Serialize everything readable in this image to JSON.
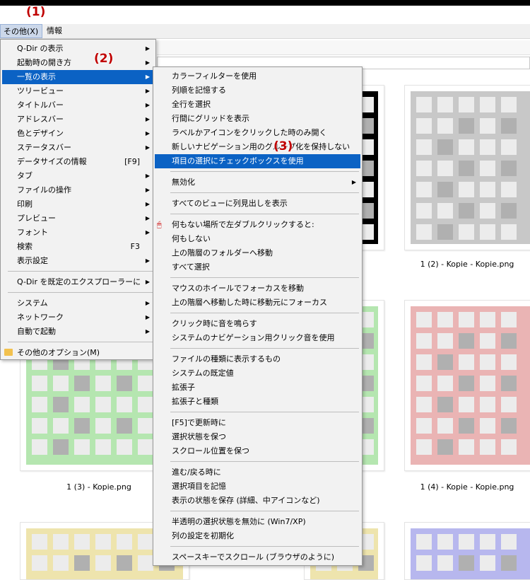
{
  "annotations": {
    "a1": "(1)",
    "a2": "(2)",
    "a3": "(3)"
  },
  "menubar": {
    "items": [
      "その他(X)",
      "情報"
    ]
  },
  "main_menu": {
    "items": [
      {
        "label": "Q-Dir の表示",
        "submenu": true
      },
      {
        "label": "起動時の開き方",
        "submenu": true
      },
      {
        "label": "一覧の表示",
        "submenu": true,
        "highlighted": true
      },
      {
        "label": "ツリービュー",
        "submenu": true
      },
      {
        "label": "タイトルバー",
        "submenu": true
      },
      {
        "label": "アドレスバー",
        "submenu": true
      },
      {
        "label": "色とデザイン",
        "submenu": true
      },
      {
        "label": "ステータスバー",
        "submenu": true
      },
      {
        "label": "データサイズの情報",
        "shortcut": "[F9]"
      },
      {
        "label": "タブ",
        "submenu": true
      },
      {
        "label": "ファイルの操作",
        "submenu": true
      },
      {
        "label": "印刷",
        "submenu": true
      },
      {
        "label": "プレビュー",
        "submenu": true
      },
      {
        "label": "フォント",
        "submenu": true
      },
      {
        "label": "検索",
        "shortcut": "F3"
      },
      {
        "label": "表示設定",
        "submenu": true
      },
      {
        "separator": true
      },
      {
        "label": "Q-Dir を既定のエクスプローラーに",
        "submenu": true
      },
      {
        "separator": true
      },
      {
        "label": "システム",
        "submenu": true
      },
      {
        "label": "ネットワーク",
        "submenu": true
      },
      {
        "label": "自動で起動",
        "submenu": true
      },
      {
        "separator": true
      },
      {
        "label": "その他のオプション(M)",
        "icon": "folder-icon"
      }
    ]
  },
  "sub_menu": {
    "items": [
      {
        "label": "カラーフィルターを使用"
      },
      {
        "label": "列順を記憶する"
      },
      {
        "label": "全行を選択"
      },
      {
        "label": "行間にグリッドを表示"
      },
      {
        "label": "ラベルかアイコンをクリックした時のみ開く"
      },
      {
        "label": "新しいナビゲーション用のグループ化を保持しない"
      },
      {
        "label": "項目の選択にチェックボックスを使用",
        "highlighted": true
      },
      {
        "separator": true
      },
      {
        "label": "無効化",
        "submenu": true
      },
      {
        "separator": true
      },
      {
        "label": "すべてのビューに列見出しを表示"
      },
      {
        "separator": true
      },
      {
        "label": "何もない場所で左ダブルクリックすると:",
        "icon": "mouse-icon"
      },
      {
        "label": "何もしない"
      },
      {
        "label": "上の階層のフォルダーへ移動"
      },
      {
        "label": "すべて選択"
      },
      {
        "separator": true
      },
      {
        "label": "マウスのホイールでフォーカスを移動"
      },
      {
        "label": "上の階層へ移動した時に移動元にフォーカス"
      },
      {
        "separator": true
      },
      {
        "label": "クリック時に音を鳴らす"
      },
      {
        "label": "システムのナビゲーション用クリック音を使用"
      },
      {
        "separator": true
      },
      {
        "label": "ファイルの種類に表示するもの"
      },
      {
        "label": "システムの既定値"
      },
      {
        "label": "拡張子"
      },
      {
        "label": "拡張子と種類"
      },
      {
        "separator": true
      },
      {
        "label": "[F5]で更新時に"
      },
      {
        "label": "選択状態を保つ"
      },
      {
        "label": "スクロール位置を保つ"
      },
      {
        "separator": true
      },
      {
        "label": "進む/戻る時に"
      },
      {
        "label": "選択項目を記憶"
      },
      {
        "label": "表示の状態を保存 (詳細、中アイコンなど)"
      },
      {
        "separator": true
      },
      {
        "label": "半透明の選択状態を無効に (Win7/XP)"
      },
      {
        "label": "列の設定を初期化"
      },
      {
        "separator": true
      },
      {
        "label": "スペースキーでスクロール (ブラウザのように)"
      }
    ]
  },
  "files": [
    {
      "name": "1 (2) - Kopie - Kopie.png",
      "color": "#c8c8c8"
    },
    {
      "name": "1 (3) - Kopie.png",
      "color": "#b5e6b0"
    },
    {
      "name": "1 (4) - Kopie - Kopie.png",
      "color": "#eab4b4"
    }
  ],
  "tile_colors": {
    "blue": "#b7b7ee",
    "yellow": "#eee4ad",
    "pattern": "#b0b0b0"
  }
}
